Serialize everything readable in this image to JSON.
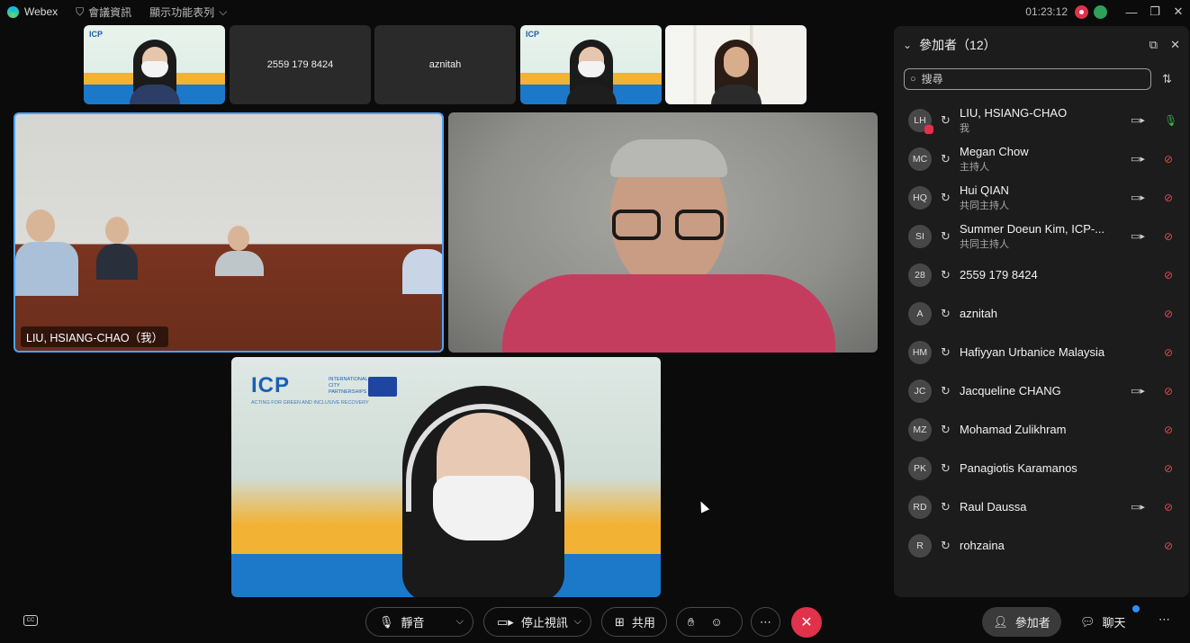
{
  "titlebar": {
    "app_name": "Webex",
    "meeting_info": "會議資訊",
    "menu_label": "顯示功能表列",
    "clock": "01:23:12"
  },
  "videos": {
    "thumb1_badge": "ICP",
    "thumb2_name": "2559 179 8424",
    "thumb3_name": "aznitah",
    "thumb4_badge": "ICP",
    "main_left_name": "LIU, HSIANG-CHAO（我）",
    "bottom_logo": "ICP",
    "bottom_sub": "INTERNATIONAL CITY PARTNERSHIPS",
    "bottom_tag": "ACTING FOR GREEN AND INCLUSIVE RECOVERY"
  },
  "panel": {
    "title": "參加者（12）",
    "search_placeholder": "搜尋",
    "participants": [
      {
        "initials": "LH",
        "name": "LIU, HSIANG-CHAO",
        "role": "我",
        "camera": true,
        "mic": "on"
      },
      {
        "initials": "MC",
        "name": "Megan Chow",
        "role": "主持人",
        "camera": true,
        "mic": "off"
      },
      {
        "initials": "HQ",
        "name": "Hui QIAN",
        "role": "共同主持人",
        "camera": true,
        "mic": "off"
      },
      {
        "initials": "SI",
        "name": "Summer Doeun Kim, ICP-...",
        "role": "共同主持人",
        "camera": true,
        "mic": "off"
      },
      {
        "initials": "28",
        "name": "2559 179 8424",
        "role": "",
        "camera": false,
        "mic": "off"
      },
      {
        "initials": "A",
        "name": "aznitah",
        "role": "",
        "camera": false,
        "mic": "off"
      },
      {
        "initials": "HM",
        "name": "Hafiyyan Urbanice Malaysia",
        "role": "",
        "camera": false,
        "mic": "off"
      },
      {
        "initials": "JC",
        "name": "Jacqueline CHANG",
        "role": "",
        "camera": true,
        "mic": "off"
      },
      {
        "initials": "MZ",
        "name": "Mohamad Zulikhram",
        "role": "",
        "camera": false,
        "mic": "off"
      },
      {
        "initials": "PK",
        "name": "Panagiotis Karamanos",
        "role": "",
        "camera": false,
        "mic": "off"
      },
      {
        "initials": "RD",
        "name": "Raul Daussa",
        "role": "",
        "camera": true,
        "mic": "off"
      },
      {
        "initials": "R",
        "name": "rohzaina",
        "role": "",
        "camera": false,
        "mic": "off"
      }
    ]
  },
  "toolbar": {
    "mute_label": "靜音",
    "video_label": "停止視訊",
    "share_label": "共用",
    "participants_label": "參加者",
    "chat_label": "聊天"
  },
  "colors": {
    "accent": "#4aa3ff",
    "end_call": "#e0324b",
    "mic_on": "#3fb950",
    "mic_off": "#e5484d"
  }
}
